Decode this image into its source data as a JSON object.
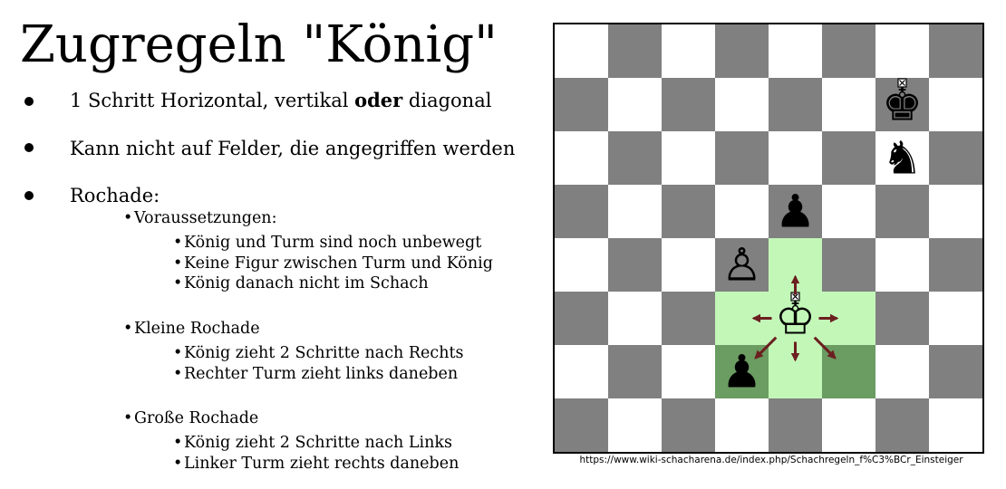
{
  "slide": {
    "title": "Zugregeln \"König\"",
    "bullets": [
      {
        "text_before": "1 Schritt Horizontal, vertikal ",
        "bold": "oder",
        "text_after": " diagonal"
      },
      {
        "text": "Kann nicht auf Felder, die angegriffen werden"
      },
      {
        "text": "Rochade:"
      }
    ],
    "rochade": {
      "voraussetzungen": {
        "label": "Voraussetzungen:",
        "items": [
          "König und Turm sind noch unbewegt",
          "Keine Figur zwischen Turm und König",
          "König danach nicht im Schach"
        ]
      },
      "kleine": {
        "label": "Kleine Rochade",
        "items": [
          "König zieht 2 Schritte nach Rechts",
          "Rechter Turm zieht links daneben"
        ]
      },
      "grosse": {
        "label": "Große Rochade",
        "items": [
          "König zieht 2 Schritte nach Links",
          "Linker Turm zieht rechts daneben"
        ]
      }
    }
  },
  "board": {
    "colors": {
      "light_square": "#ffffff",
      "dark_square": "#808080",
      "highlight_light": "#c3f7b8",
      "highlight_dark": "#6b9c62",
      "arrow": "#6b1f1f"
    },
    "pieces": [
      {
        "row": 1,
        "col": 6,
        "glyph": "♚",
        "side": "black",
        "kind": "king",
        "marked": true
      },
      {
        "row": 2,
        "col": 6,
        "glyph": "♞",
        "side": "black",
        "kind": "knight",
        "marked": false
      },
      {
        "row": 3,
        "col": 4,
        "glyph": "♟",
        "side": "black",
        "kind": "pawn",
        "marked": false
      },
      {
        "row": 4,
        "col": 3,
        "glyph": "♙",
        "side": "white",
        "kind": "pawn",
        "marked": false
      },
      {
        "row": 5,
        "col": 4,
        "glyph": "♔",
        "side": "white",
        "kind": "king",
        "marked": true
      },
      {
        "row": 6,
        "col": 3,
        "glyph": "♟",
        "side": "black",
        "kind": "pawn",
        "marked": false
      }
    ],
    "highlights": [
      {
        "row": 4,
        "col": 4,
        "tone": "light"
      },
      {
        "row": 5,
        "col": 3,
        "tone": "light"
      },
      {
        "row": 5,
        "col": 4,
        "tone": "light"
      },
      {
        "row": 5,
        "col": 5,
        "tone": "light"
      },
      {
        "row": 6,
        "col": 3,
        "tone": "dark"
      },
      {
        "row": 6,
        "col": 4,
        "tone": "light"
      },
      {
        "row": 6,
        "col": 5,
        "tone": "dark"
      }
    ],
    "arrows": [
      {
        "from": [
          5,
          4
        ],
        "to": [
          4,
          4
        ]
      },
      {
        "from": [
          5,
          4
        ],
        "to": [
          5,
          3
        ]
      },
      {
        "from": [
          5,
          4
        ],
        "to": [
          5,
          5
        ]
      },
      {
        "from": [
          5,
          4
        ],
        "to": [
          6,
          3
        ]
      },
      {
        "from": [
          5,
          4
        ],
        "to": [
          6,
          4
        ]
      },
      {
        "from": [
          5,
          4
        ],
        "to": [
          6,
          5
        ]
      }
    ]
  },
  "source": "https://www.wiki-schacharena.de/index.php/Schachregeln_f%C3%BCr_Einsteiger"
}
